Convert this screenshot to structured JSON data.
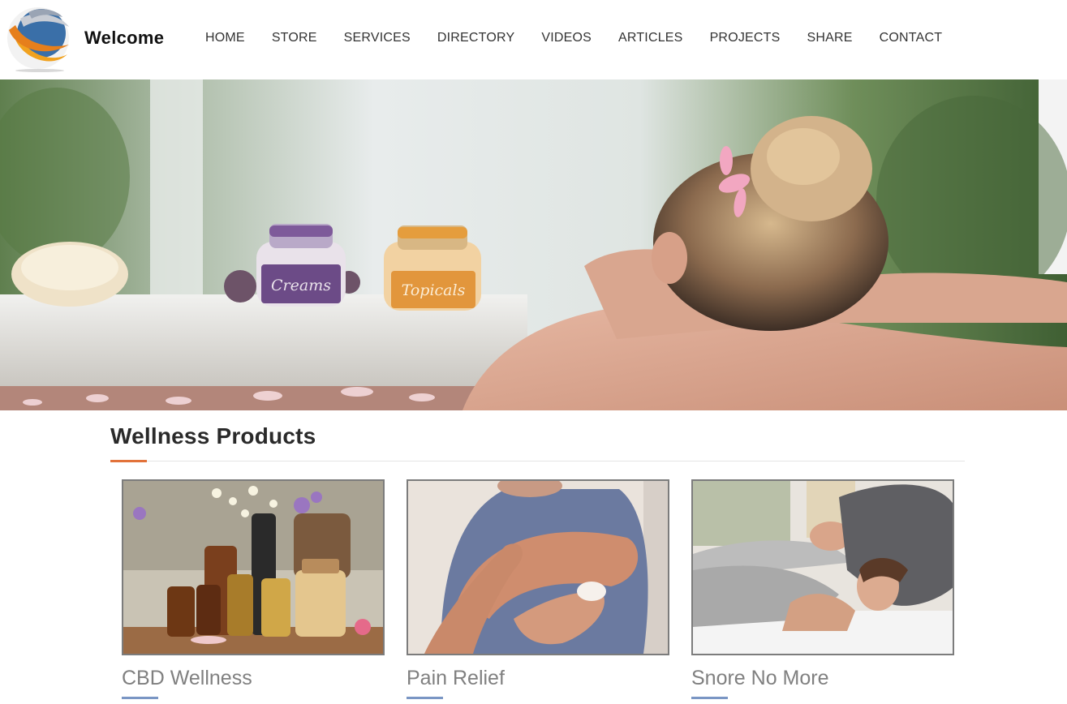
{
  "header": {
    "brand": "Welcome",
    "nav": [
      "HOME",
      "STORE",
      "SERVICES",
      "DIRECTORY",
      "VIDEOS",
      "ARTICLES",
      "PROJECTS",
      "SHARE",
      "CONTACT"
    ]
  },
  "hero": {
    "jar1_label": "Creams",
    "jar2_label": "Topicals"
  },
  "section": {
    "title": "Wellness Products"
  },
  "products": [
    {
      "title": "CBD Wellness"
    },
    {
      "title": "Pain Relief"
    },
    {
      "title": "Snore No More"
    }
  ],
  "colors": {
    "accent": "#e2723a",
    "underline": "#7a96c4",
    "product_title": "#808080"
  }
}
